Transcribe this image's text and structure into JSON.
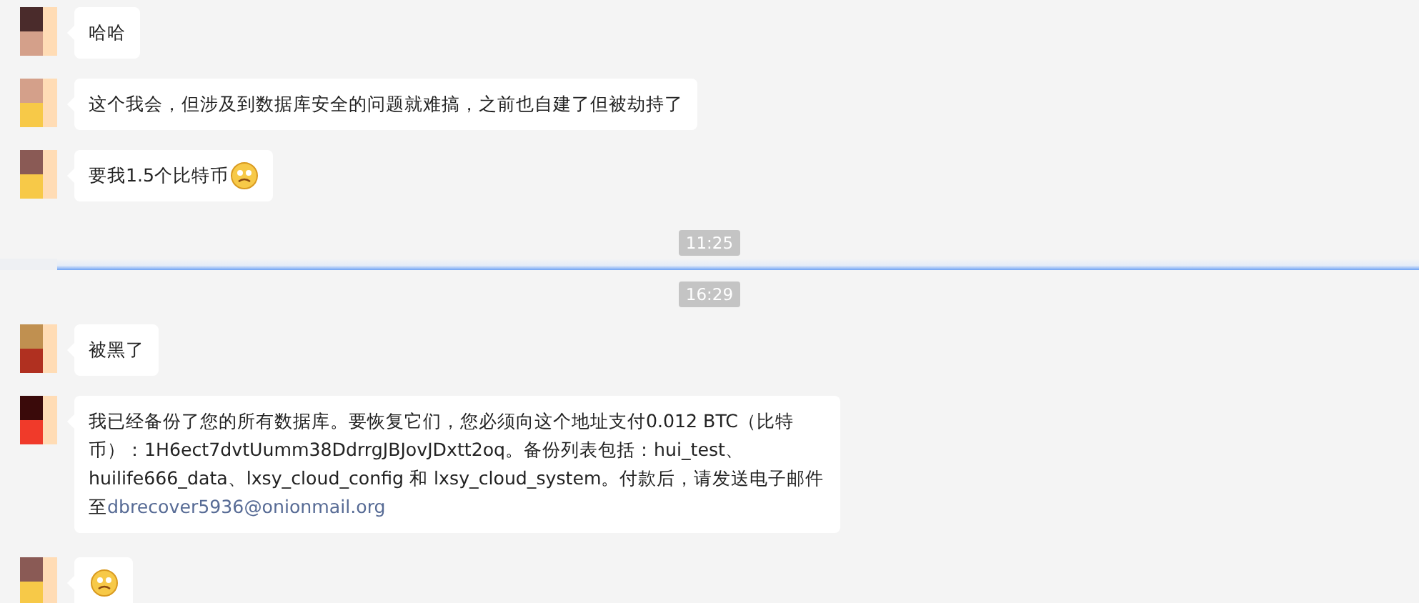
{
  "items": [
    {
      "kind": "message",
      "text": "哈哈",
      "emoji": false
    },
    {
      "kind": "message",
      "text": "这个我会，但涉及到数据库安全的问题就难搞，之前也自建了但被劫持了",
      "emoji": false
    },
    {
      "kind": "message",
      "text": "要我1.5个比特币",
      "emoji": true
    },
    {
      "kind": "time",
      "text": "11:25",
      "divider": true
    },
    {
      "kind": "time",
      "text": "16:29",
      "divider": false
    },
    {
      "kind": "message",
      "text": "被黑了",
      "emoji": false
    },
    {
      "kind": "message",
      "text": "我已经备份了您的所有数据库。要恢复它们，您必须向这个地址支付0.012 BTC（比特币）：1H6ect7dvtUumm38DdrrgJBJovJDxtt2oq。备份列表包括：hui_test、huilife666_data、lxsy_cloud_config 和 lxsy_cloud_system。付款后，请发送电子邮件至",
      "link": "dbrecover5936@onionmail.org",
      "emoji": false
    },
    {
      "kind": "message",
      "emoji": true
    }
  ]
}
